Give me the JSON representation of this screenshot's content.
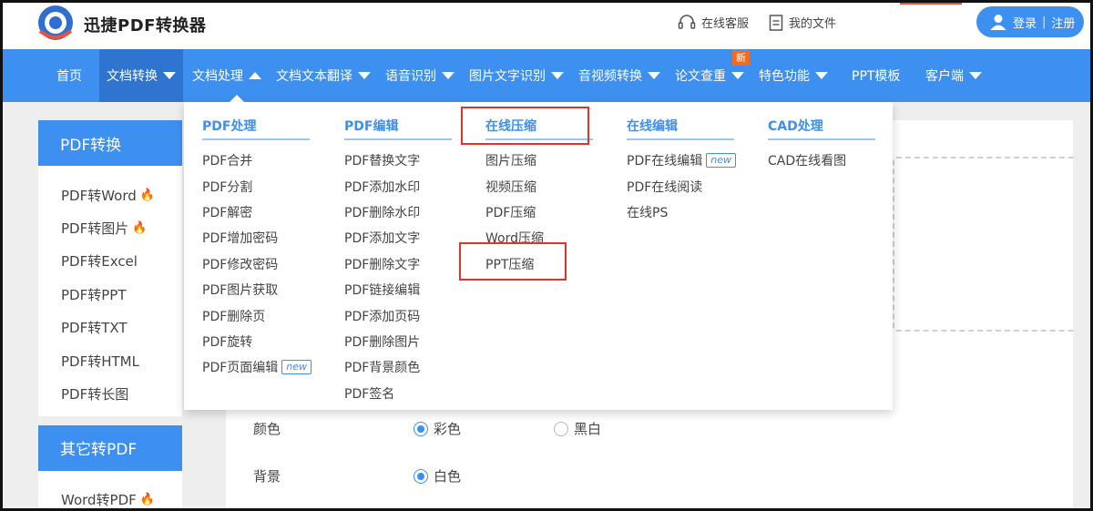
{
  "header": {
    "brand": "迅捷PDF转换器",
    "support_label": "在线客服",
    "files_label": "我的文件",
    "login_label": "登录",
    "register_label": "注册",
    "login_separator": "|"
  },
  "nav": {
    "items": [
      {
        "label": "首页"
      },
      {
        "label": "文档转换"
      },
      {
        "label": "文档处理"
      },
      {
        "label": "文档文本翻译"
      },
      {
        "label": "语音识别"
      },
      {
        "label": "图片文字识别"
      },
      {
        "label": "音视频转换"
      },
      {
        "label": "论文查重"
      },
      {
        "label": "特色功能"
      },
      {
        "label": "PPT模板"
      },
      {
        "label": "客户端"
      }
    ],
    "new_badge": "新"
  },
  "dropdown": {
    "columns": [
      {
        "title": "PDF处理",
        "items": [
          "PDF合并",
          "PDF分割",
          "PDF解密",
          "PDF增加密码",
          "PDF修改密码",
          "PDF图片获取",
          "PDF删除页",
          "PDF旋转",
          "PDF页面编辑"
        ]
      },
      {
        "title": "PDF编辑",
        "items": [
          "PDF替换文字",
          "PDF添加水印",
          "PDF删除水印",
          "PDF添加文字",
          "PDF删除文字",
          "PDF链接编辑",
          "PDF添加页码",
          "PDF删除图片",
          "PDF背景颜色",
          "PDF签名"
        ]
      },
      {
        "title": "在线压缩",
        "items": [
          "图片压缩",
          "视频压缩",
          "PDF压缩",
          "Word压缩",
          "PPT压缩"
        ]
      },
      {
        "title": "在线编辑",
        "items": [
          "PDF在线编辑",
          "PDF在线阅读",
          "在线PS"
        ]
      },
      {
        "title": "CAD处理",
        "items": [
          "CAD在线看图"
        ]
      }
    ],
    "new_tag": "new"
  },
  "sidebar": {
    "group1_title": "PDF转换",
    "group1_items": [
      "PDF转Word",
      "PDF转图片",
      "PDF转Excel",
      "PDF转PPT",
      "PDF转TXT",
      "PDF转HTML",
      "PDF转长图"
    ],
    "group2_title": "其它转PDF",
    "group2_items": [
      "Word转PDF"
    ]
  },
  "options": {
    "color_label": "颜色",
    "color_opt1": "彩色",
    "color_opt2": "黑白",
    "bg_label": "背景",
    "bg_opt1": "白色"
  },
  "colors": {
    "primary": "#3d8ff0",
    "highlight_box": "#e0332b",
    "new_badge": "#f26b21"
  }
}
